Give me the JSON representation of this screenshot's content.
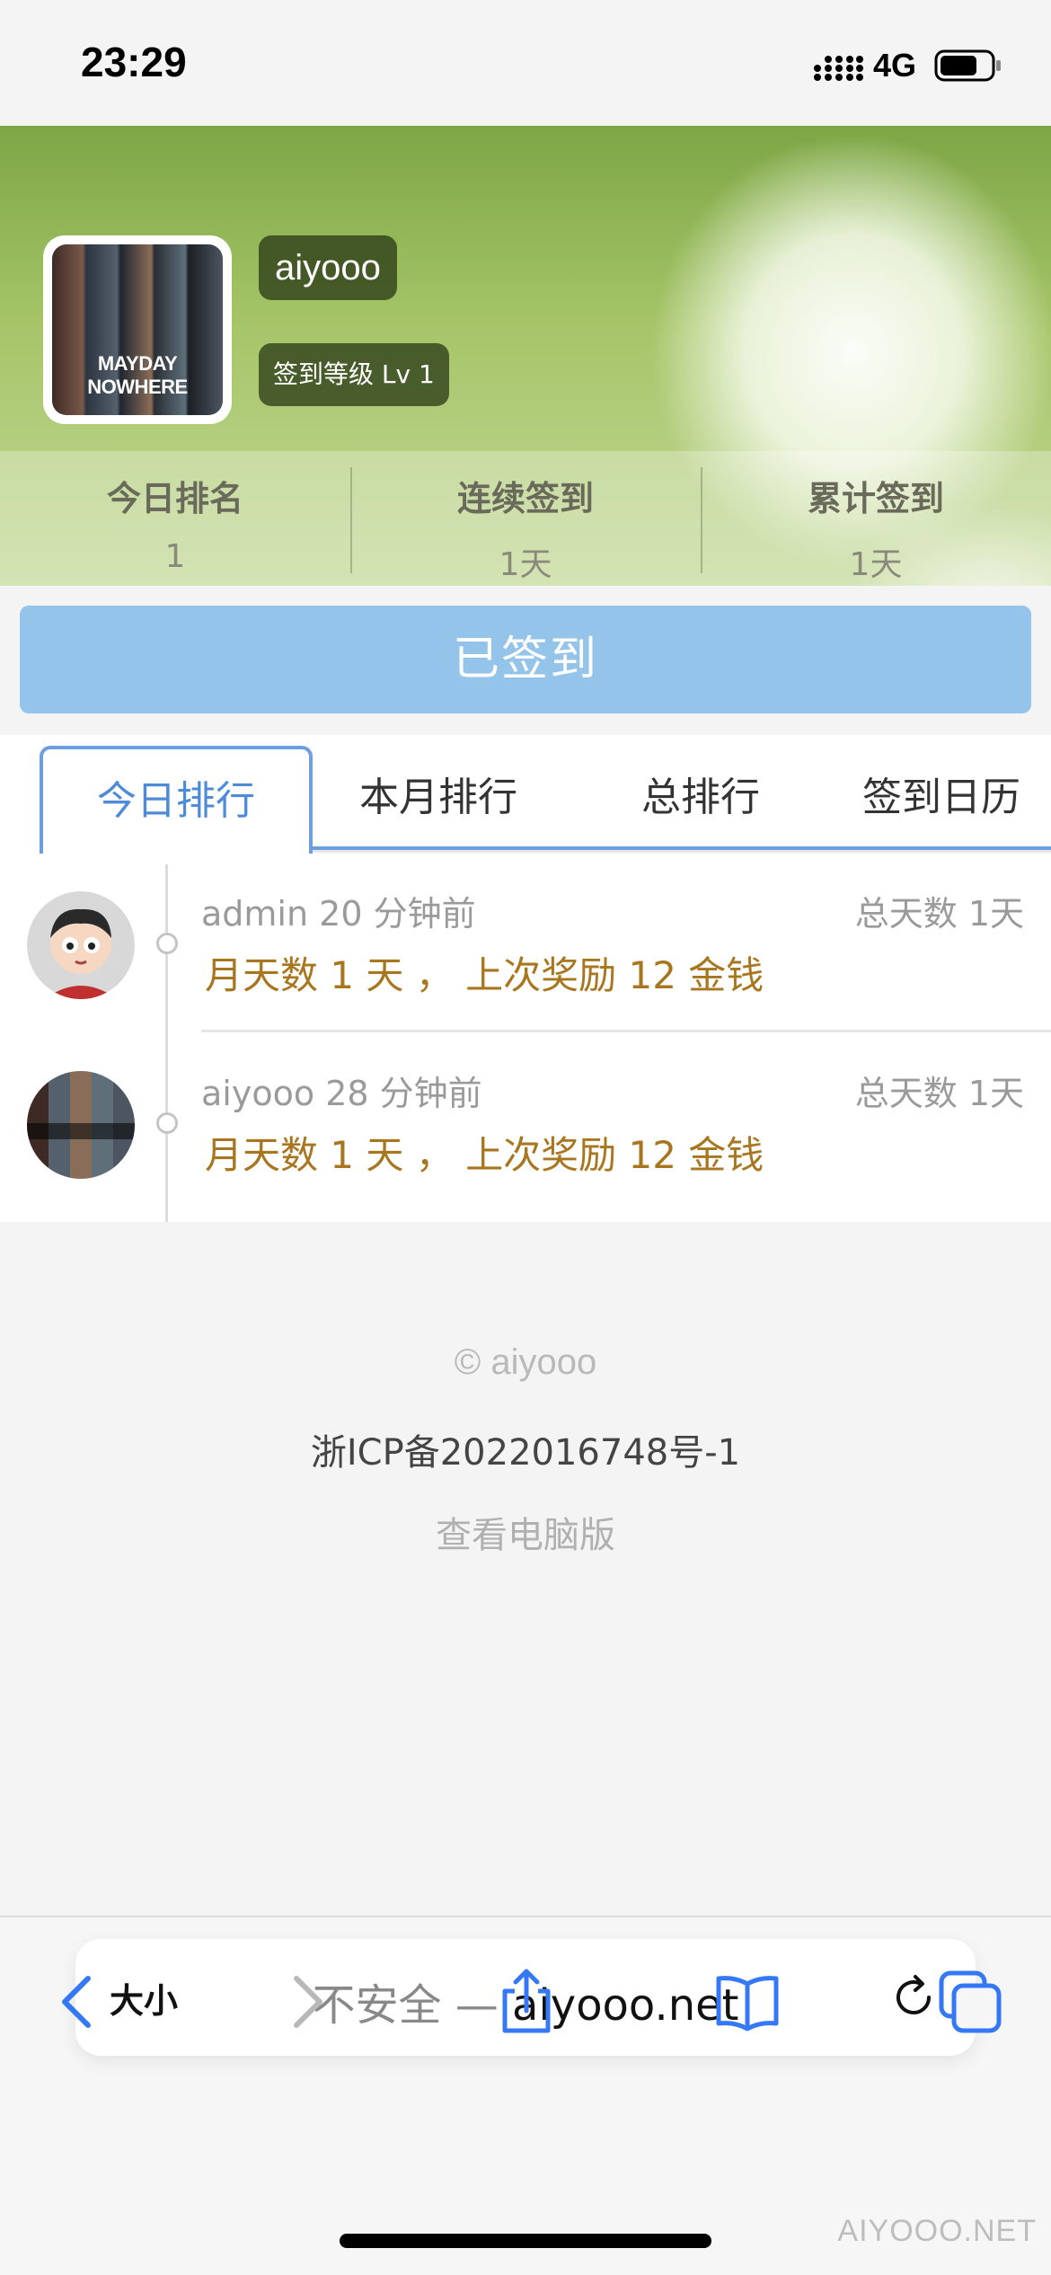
{
  "status_bar": {
    "time": "23:29",
    "network": "4G"
  },
  "profile": {
    "username": "aiyooo",
    "level": "签到等级 Lv 1",
    "avatar_text": "MAYDAY NOWHERE"
  },
  "stats": [
    {
      "label": "今日排名",
      "value": "1"
    },
    {
      "label": "连续签到",
      "value": "1天"
    },
    {
      "label": "累计签到",
      "value": "1天"
    }
  ],
  "sign_button": {
    "label": "已签到"
  },
  "tabs": [
    {
      "label": "今日排行",
      "active": true
    },
    {
      "label": "本月排行",
      "active": false
    },
    {
      "label": "总排行",
      "active": false
    },
    {
      "label": "签到日历",
      "active": false
    }
  ],
  "ranking": [
    {
      "user": "admin",
      "time": "20 分钟前",
      "total": "总天数 1天",
      "detail": "月天数 1 天 ，  上次奖励 12 金钱"
    },
    {
      "user": "aiyooo",
      "time": "28 分钟前",
      "total": "总天数 1天",
      "detail": "月天数 1 天 ，  上次奖励 12 金钱"
    }
  ],
  "footer": {
    "copyright": "© aiyooo",
    "icp": "浙ICP备2022016748号-1",
    "desktop_link": "查看电脑版"
  },
  "browser": {
    "size_label": "大小",
    "insecure_label": "不安全 —",
    "domain": "aiyooo.net"
  },
  "watermark": "AIYOOO.NET",
  "colors": {
    "accent": "#6c9ee0",
    "sign_button": "#94c4ea",
    "reward_text": "#a8761e",
    "banner_green": "#8db556"
  },
  "icons": [
    "signal-icon",
    "battery-icon",
    "reload-icon",
    "back-icon",
    "forward-icon",
    "share-icon",
    "bookmarks-icon",
    "tabs-icon"
  ]
}
